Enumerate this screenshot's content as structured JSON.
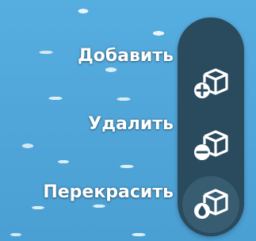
{
  "menu": {
    "items": [
      {
        "label": "Добавить",
        "icon": "box-plus-icon"
      },
      {
        "label": "Удалить",
        "icon": "box-minus-icon"
      },
      {
        "label": "Перекрасить",
        "icon": "box-paint-drop-icon"
      }
    ],
    "active_index": 2
  },
  "colors": {
    "background": "#4FA6D8",
    "panel": "#2A4A5D",
    "active_slot": "#385C70",
    "text": "#FFFFFF"
  }
}
